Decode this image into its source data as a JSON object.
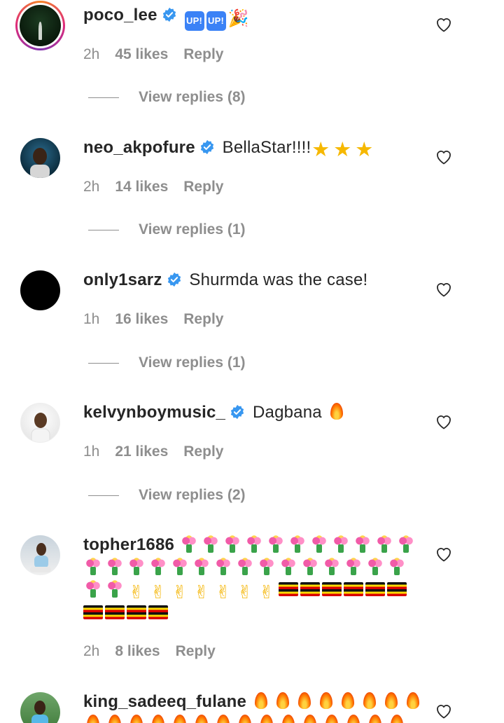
{
  "comments": [
    {
      "username": "poco_lee",
      "verified": true,
      "text": "",
      "emojis": [
        "up",
        "up",
        "party"
      ],
      "time": "2h",
      "likes": "45 likes",
      "reply": "Reply",
      "view_replies": "View replies (8)"
    },
    {
      "username": "neo_akpofure",
      "verified": true,
      "text": "BellaStar!!!!",
      "emojis": [
        "star",
        "star",
        "star"
      ],
      "time": "2h",
      "likes": "14 likes",
      "reply": "Reply",
      "view_replies": "View replies (1)"
    },
    {
      "username": "only1sarz",
      "verified": true,
      "text": "Shurmda was the case!",
      "emojis": [],
      "time": "1h",
      "likes": "16 likes",
      "reply": "Reply",
      "view_replies": "View replies (1)"
    },
    {
      "username": "kelvynboymusic_",
      "verified": true,
      "text": "Dagbana",
      "emojis": [
        "fire"
      ],
      "time": "1h",
      "likes": "21 likes",
      "reply": "Reply",
      "view_replies": "View replies (2)"
    },
    {
      "username": "topher1686",
      "verified": false,
      "text": "",
      "emojis": [
        "flower",
        "flower",
        "flower",
        "flower",
        "flower",
        "flower",
        "flower",
        "flower",
        "flower",
        "flower",
        "flower",
        "flower",
        "flower",
        "flower",
        "flower",
        "flower",
        "flower",
        "flower",
        "flower",
        "flower",
        "flower",
        "flower",
        "flower",
        "flower",
        "flower",
        "flower",
        "flower",
        "flower",
        "victory",
        "victory",
        "victory",
        "victory",
        "victory",
        "victory",
        "victory",
        "flag-uganda",
        "flag-uganda",
        "flag-uganda",
        "flag-uganda",
        "flag-uganda",
        "flag-uganda",
        "flag-uganda",
        "flag-uganda",
        "flag-uganda",
        "flag-uganda"
      ],
      "time": "2h",
      "likes": "8 likes",
      "reply": "Reply",
      "view_replies": ""
    },
    {
      "username": "king_sadeeq_fulane",
      "verified": false,
      "text": "",
      "emojis": [
        "fire",
        "fire",
        "fire",
        "fire",
        "fire",
        "fire",
        "fire",
        "fire",
        "fire",
        "fire",
        "fire",
        "fire",
        "fire",
        "fire",
        "fire",
        "fire",
        "fire",
        "fire",
        "fire",
        "fire",
        "fire",
        "fire",
        "fire",
        "fire",
        "fire"
      ],
      "time": "",
      "likes": "",
      "reply": "",
      "view_replies": ""
    }
  ],
  "colors": {
    "verified_badge": "#3897f0",
    "secondary_text": "#8e8e8e",
    "primary_text": "#262626"
  },
  "icons": {
    "verified": "verified-badge-icon",
    "like": "heart-outline-icon"
  }
}
